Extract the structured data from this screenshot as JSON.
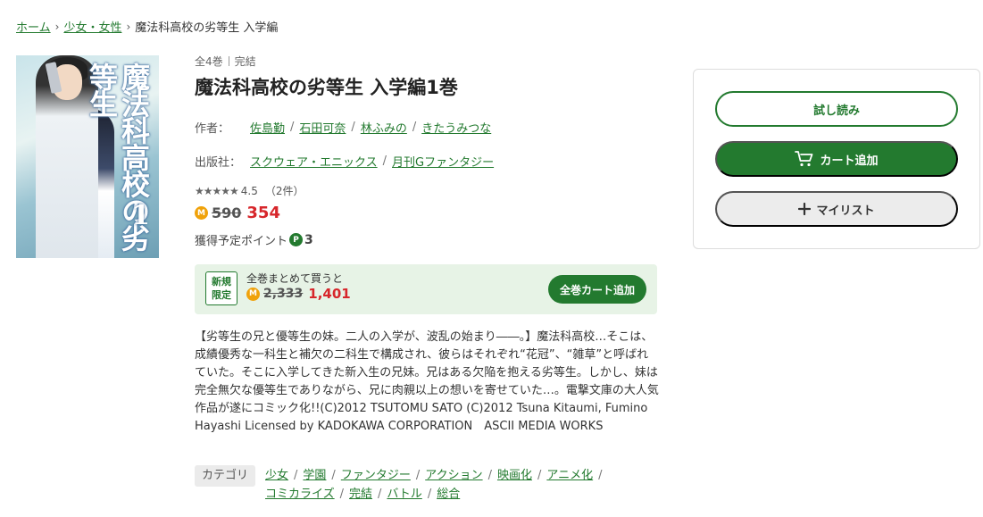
{
  "breadcrumb": {
    "home": "ホーム",
    "category": "少女・女性",
    "current": "魔法科高校の劣等生 入学編"
  },
  "cover": {
    "title_text": "魔法科高校の劣等生",
    "volume_number": "1"
  },
  "meta": {
    "volumes": "全4巻",
    "status": "完結"
  },
  "title": "魔法科高校の劣等生 入学編1巻",
  "authors": {
    "label": "作者：",
    "names": [
      "佐島勤",
      "石田可奈",
      "林ふみの",
      "きたうみつな"
    ]
  },
  "publisher": {
    "label": "出版社：",
    "names": [
      "スクウェア・エニックス",
      "月刊Gファンタジー"
    ]
  },
  "rating": {
    "stars": "★★★★★",
    "stars_value": 5,
    "score": "4.5",
    "count": "（2件）"
  },
  "price": {
    "coin_icon_label": "M",
    "original": "590",
    "sale": "354"
  },
  "points": {
    "label": "獲得予定ポイント",
    "icon_label": "P",
    "value": "3"
  },
  "bundle": {
    "badge_line1": "新規",
    "badge_line2": "限定",
    "text": "全巻まとめて買うと",
    "original": "2,333",
    "sale": "1,401",
    "button": "全巻カート追加"
  },
  "description": "【劣等生の兄と優等生の妹。二人の入学が、波乱の始まり――。】魔法科高校…そこは、成績優秀な一科生と補欠の二科生で構成され、彼らはそれぞれ“花冠”、“雑草”と呼ばれていた。そこに入学してきた新入生の兄妹。兄はある欠陥を抱える劣等生。しかし、妹は完全無欠な優等生でありながら、兄に肉親以上の想いを寄せていた…。電撃文庫の大人気作品が遂にコミック化!!(C)2012 TSUTOMU SATO (C)2012 Tsuna Kitaumi, Fumino Hayashi Licensed by KADOKAWA CORPORATION　ASCII MEDIA WORKS",
  "categories": {
    "label": "カテゴリ",
    "items": [
      "少女",
      "学園",
      "ファンタジー",
      "アクション",
      "映画化",
      "アニメ化",
      "コミカライズ",
      "完結",
      "バトル",
      "総合"
    ]
  },
  "actions": {
    "trial": "試し読み",
    "cart": "カート追加",
    "mylist": "マイリスト"
  },
  "colors": {
    "accent": "#237a2f",
    "sale": "#d7262b",
    "bundle_bg": "#e7f3e6",
    "coin": "#f0a20a"
  }
}
